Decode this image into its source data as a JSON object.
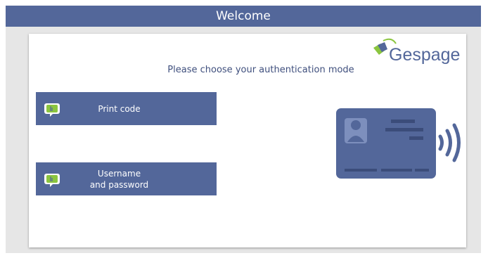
{
  "window": {
    "title": "Welcome"
  },
  "brand": {
    "logo_text": "Gespage",
    "color": "#53679a"
  },
  "main": {
    "prompt": "Please choose your authentication mode",
    "modes": [
      {
        "label_line1": "Print code",
        "label_line2": "",
        "icon": "touch-screen-icon"
      },
      {
        "label_line1": "Username",
        "label_line2": "and password",
        "icon": "touch-screen-icon"
      }
    ],
    "graphic": "contactless-card-icon"
  },
  "colors": {
    "accent": "#53679a",
    "icon_green": "#8bc53f",
    "background": "#e6e6e6"
  }
}
